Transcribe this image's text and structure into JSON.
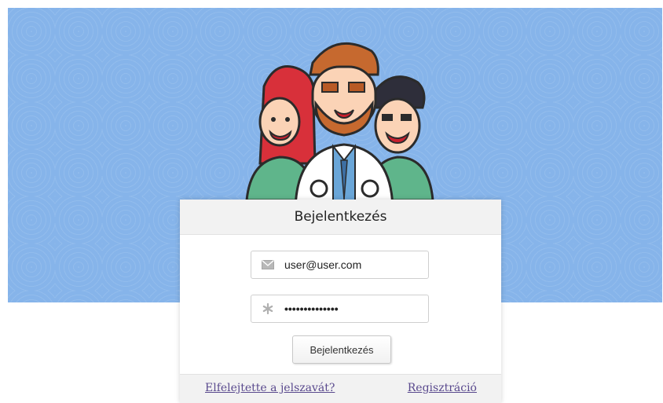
{
  "login": {
    "title": "Bejelentkezés",
    "email": {
      "value": "user@user.com",
      "icon": "envelope-icon"
    },
    "password": {
      "value": "••••••••••••••",
      "icon": "asterisk-icon"
    },
    "submit_label": "Bejelentkezés",
    "forgot_label": "Elfelejtette a jelszavát?",
    "register_label": "Regisztráció"
  },
  "hero": {
    "illustration": "doctors-illustration"
  },
  "colors": {
    "hero_background": "#86b4ea",
    "link": "#5a4a8e",
    "panel": "#f2f2f2"
  }
}
